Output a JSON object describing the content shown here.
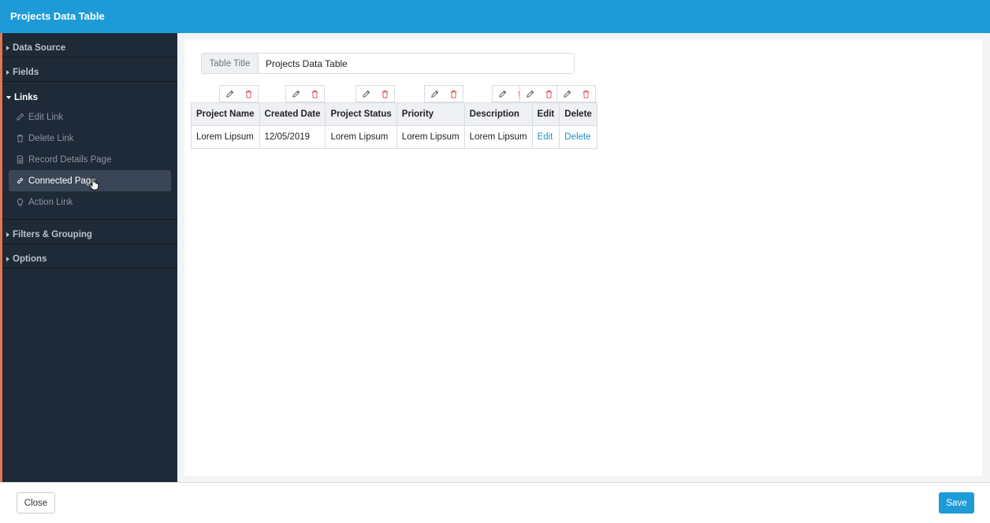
{
  "window": {
    "title": "Projects Data Table"
  },
  "sidebar": {
    "sections": [
      {
        "label": "Data Source"
      },
      {
        "label": "Fields"
      },
      {
        "label": "Links"
      },
      {
        "label": "Filters & Grouping"
      },
      {
        "label": "Options"
      }
    ],
    "links_items": [
      {
        "label": "Edit Link",
        "icon": "pencil-icon"
      },
      {
        "label": "Delete Link",
        "icon": "trash-icon"
      },
      {
        "label": "Record Details Page",
        "icon": "document-icon"
      },
      {
        "label": "Connected Page",
        "icon": "link-icon",
        "active": true
      },
      {
        "label": "Action Link",
        "icon": "lightbulb-icon"
      }
    ]
  },
  "main": {
    "title_label": "Table Title",
    "title_value": "Projects Data Table",
    "table": {
      "headers": [
        "Project Name",
        "Created Date",
        "Project Status",
        "Priority",
        "Description",
        "Edit",
        "Delete"
      ],
      "rows": [
        [
          "Lorem Lipsum",
          "12/05/2019",
          "Lorem Lipsum",
          "Lorem Lipsum",
          "Lorem Lipsum",
          "Edit",
          "Delete"
        ]
      ]
    }
  },
  "footer": {
    "close_label": "Close",
    "save_label": "Save"
  },
  "colors": {
    "accent": "#1e9bd7",
    "sidebar": "#1f2a38",
    "sidebar_edge": "#e0774e",
    "delete_icon": "#e0454f",
    "link": "#1e8fc6"
  }
}
